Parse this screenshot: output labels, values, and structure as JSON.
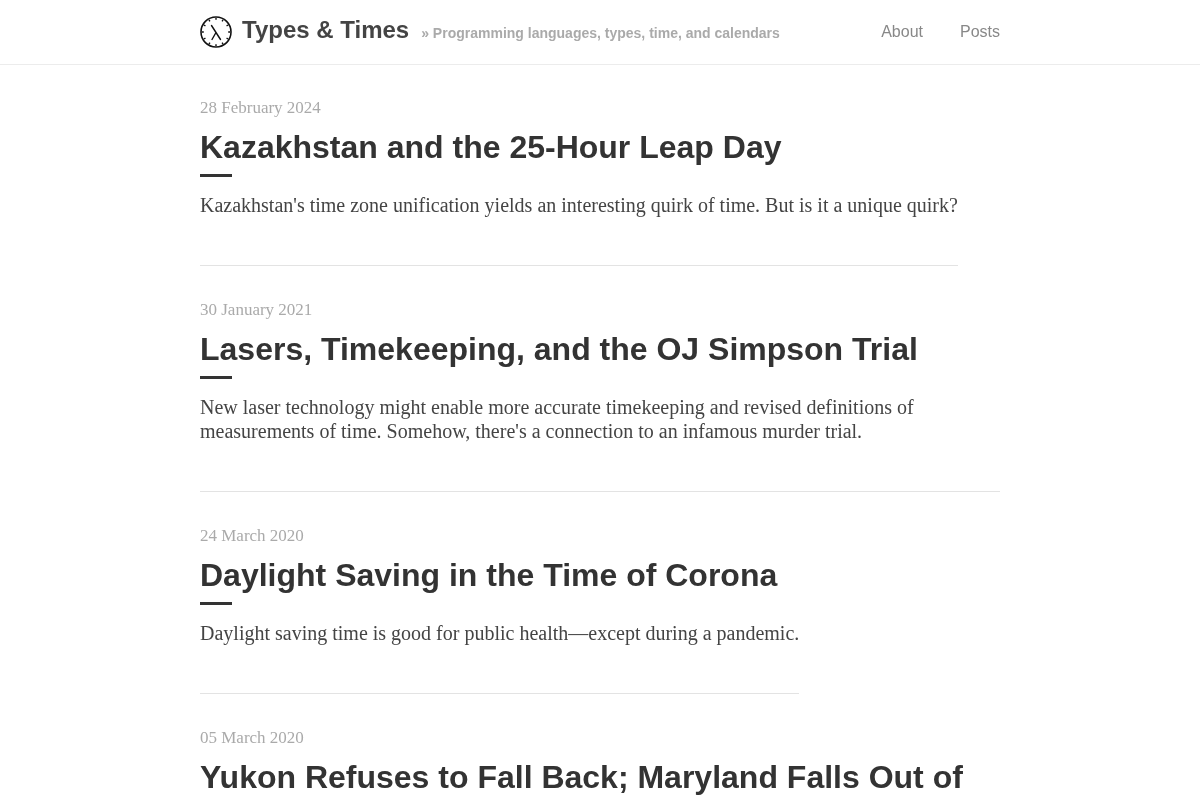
{
  "header": {
    "site_title": "Types & Times",
    "tagline": "» Programming languages, types, time, and calendars",
    "nav": [
      {
        "label": "About"
      },
      {
        "label": "Posts"
      }
    ]
  },
  "posts": [
    {
      "date": "28 February 2024",
      "title": "Kazakhstan and the 25-Hour Leap Day",
      "summary": "Kazakhstan's time zone unification yields an interesting quirk of time. But is it a unique quirk?"
    },
    {
      "date": "30 January 2021",
      "title": "Lasers, Timekeeping, and the OJ Simpson Trial",
      "summary": "New laser technology might enable more accurate timekeeping and revised definitions of measurements of time. Somehow, there's a connection to an infamous murder trial."
    },
    {
      "date": "24 March 2020",
      "title": "Daylight Saving in the Time of Corona",
      "summary": "Daylight saving time is good for public health—except during a pandemic."
    },
    {
      "date": "05 March 2020",
      "title": "Yukon Refuses to Fall Back; Maryland Falls Out of"
    }
  ]
}
